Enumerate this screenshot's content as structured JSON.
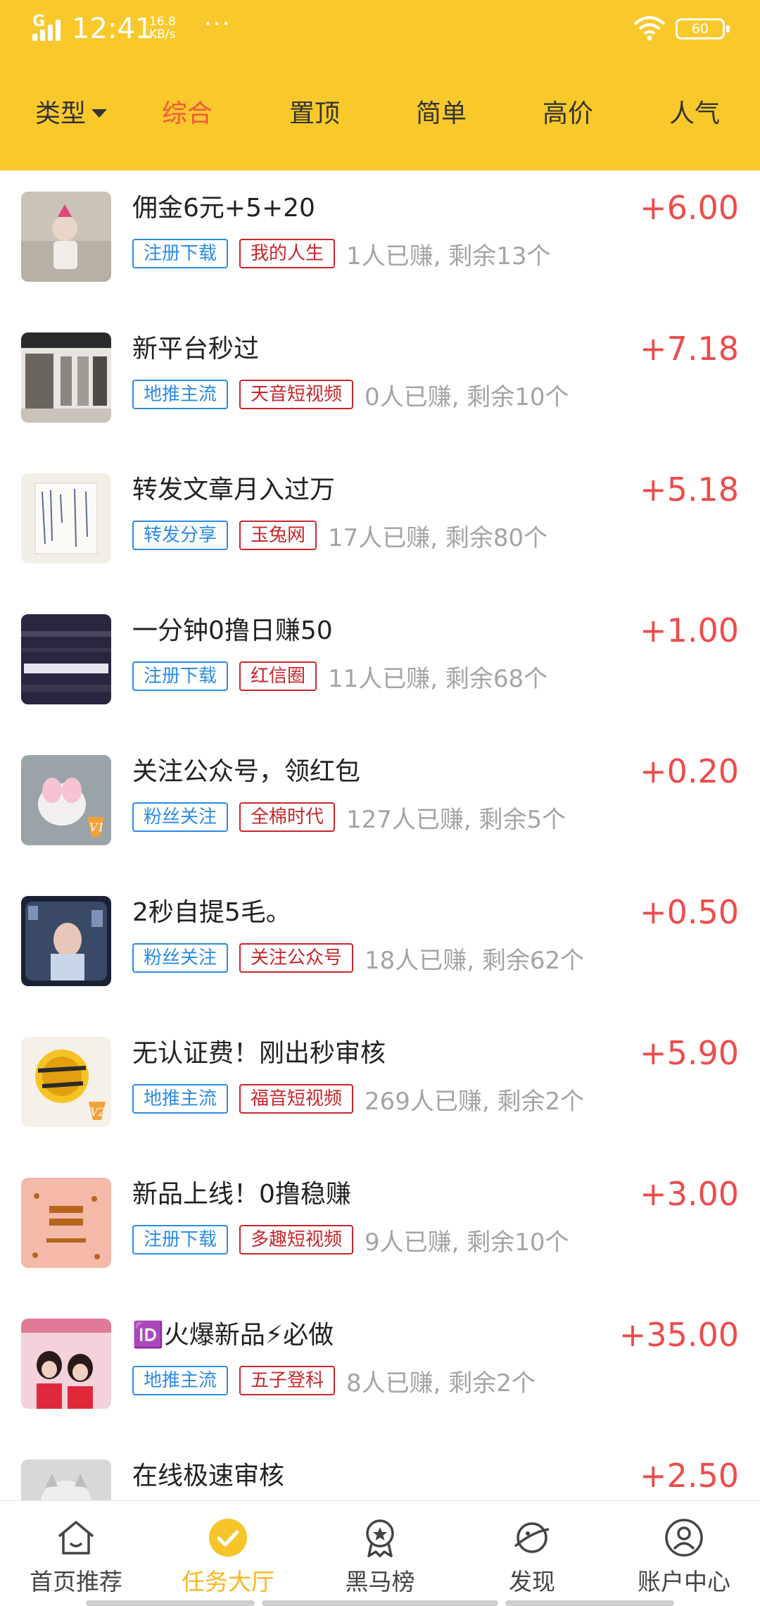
{
  "status_bar": {
    "network": "G",
    "time": "12:41",
    "speed_value": "16.8",
    "speed_unit": "KB/s",
    "more": "···",
    "battery": "60"
  },
  "filters": {
    "type_label": "类型",
    "tabs": [
      {
        "label": "综合",
        "active": true
      },
      {
        "label": "置顶",
        "active": false
      },
      {
        "label": "简单",
        "active": false
      },
      {
        "label": "高价",
        "active": false
      },
      {
        "label": "人气",
        "active": false
      }
    ]
  },
  "tasks": [
    {
      "title": "佣金6元+5+20",
      "price": "+6.00",
      "tag1": "注册下载",
      "tag2": "我的人生",
      "meta": "1人已赚, 剩余13个",
      "thumb_color": "#c9c3b8"
    },
    {
      "title": "新平台秒过",
      "price": "+7.18",
      "tag1": "地推主流",
      "tag2": "天音短视频",
      "meta": "0人已赚, 剩余10个",
      "thumb_color": "#6b6560"
    },
    {
      "title": "转发文章月入过万",
      "price": "+5.18",
      "tag1": "转发分享",
      "tag2": "玉兔网",
      "meta": "17人已赚, 剩余80个",
      "thumb_color": "#f2efe6"
    },
    {
      "title": "一分钟0撸日赚50",
      "price": "+1.00",
      "tag1": "注册下载",
      "tag2": "红信圈",
      "meta": "11人已赚, 剩余68个",
      "thumb_color": "#2a2540",
      "thumb_text": "永远不要与趋势为敌"
    },
    {
      "title": "关注公众号，领红包",
      "price": "+0.20",
      "tag1": "粉丝关注",
      "tag2": "全棉时代",
      "meta": "127人已赚, 剩余5个",
      "thumb_color": "#9aa3a8",
      "badge": "V1"
    },
    {
      "title": "2秒自提5毛。",
      "price": "+0.50",
      "tag1": "粉丝关注",
      "tag2": "关注公众号",
      "meta": "18人已赚, 剩余62个",
      "thumb_color": "#3a4a66"
    },
    {
      "title": "无认证费！刚出秒审核",
      "price": "+5.90",
      "tag1": "地推主流",
      "tag2": "福音短视频",
      "meta": "269人已赚, 剩余2个",
      "thumb_color": "#f6f1e8",
      "badge": "V2"
    },
    {
      "title": "新品上线！0撸稳赚",
      "price": "+3.00",
      "tag1": "注册下载",
      "tag2": "多趣短视频",
      "meta": "9人已赚, 剩余10个",
      "thumb_color": "#f4b9a8",
      "thumb_text": "暴富",
      "thumb_sub": "FatChoy"
    },
    {
      "title": "🆔火爆新品⚡必做",
      "price": "+35.00",
      "tag1": "地推主流",
      "tag2": "五子登科",
      "meta": "8人已赚, 剩余2个",
      "thumb_color": "#e8a0b0"
    },
    {
      "title": "在线极速审核",
      "price": "+2.50",
      "tag1": "",
      "tag2": "",
      "meta": "",
      "thumb_color": "#d8d8d8"
    }
  ],
  "nav": [
    {
      "label": "首页推荐",
      "icon": "home-icon",
      "active": false
    },
    {
      "label": "任务大厅",
      "icon": "check-icon",
      "active": true
    },
    {
      "label": "黑马榜",
      "icon": "medal-icon",
      "active": false
    },
    {
      "label": "发现",
      "icon": "planet-icon",
      "active": false
    },
    {
      "label": "账户中心",
      "icon": "user-icon",
      "active": false
    }
  ],
  "colors": {
    "header": "#f9c92c",
    "accent": "#f4573b",
    "price": "#ef4b4b",
    "tag_blue": "#2b8be6",
    "tag_red": "#c9252b",
    "nav_active": "#f5b922"
  }
}
